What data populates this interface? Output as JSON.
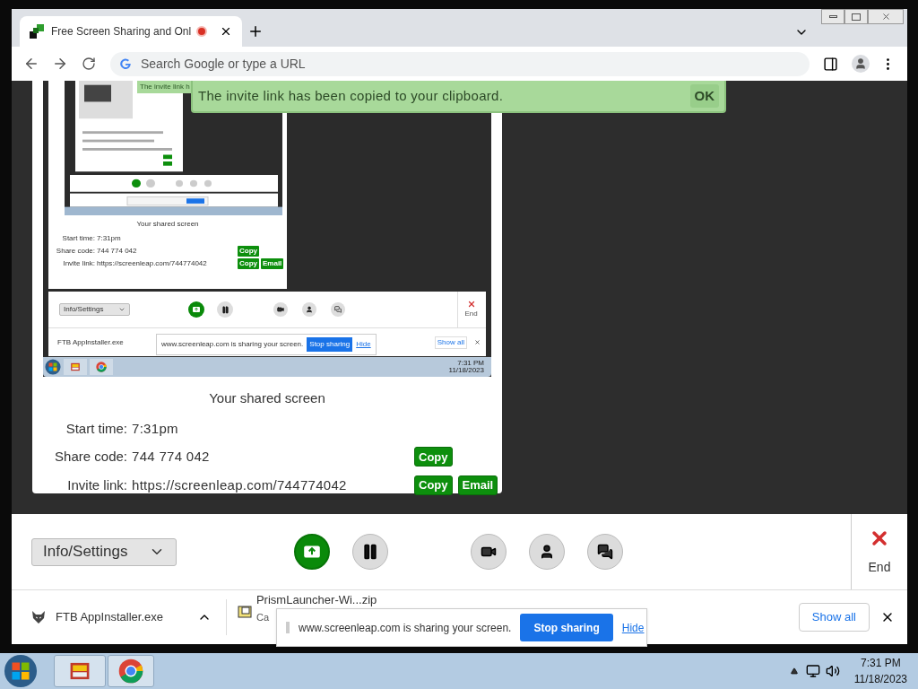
{
  "browser": {
    "tab": {
      "title": "Free Screen Sharing and Onl",
      "recording": true
    },
    "address_bar": {
      "placeholder": "Search Google or type a URL"
    }
  },
  "toast": {
    "message": "The invite link has been copied to your clipboard.",
    "button": "OK"
  },
  "preview": {
    "toast": "The invite link h",
    "heading": "Your shared screen",
    "rows": [
      {
        "label": "Start time:",
        "value": "7:31pm"
      },
      {
        "label": "Share code:",
        "value": "744 774 042",
        "buttons": [
          "Copy"
        ]
      },
      {
        "label": "Invite link:",
        "value": "https://screenleap.com/744774042",
        "buttons": [
          "Copy",
          "Email"
        ]
      }
    ],
    "dropdown": "Info/Settings",
    "end": "End",
    "download": "FTB AppInstaller.exe",
    "sharing_bar": {
      "message": "www.screenleap.com is sharing your screen.",
      "stop": "Stop sharing",
      "hide": "Hide"
    },
    "show_all": "Show all",
    "time": "7:31 PM",
    "date": "11/18/2023"
  },
  "shared_screen": {
    "heading": "Your shared screen",
    "rows": [
      {
        "label": "Start time:",
        "value": "7:31pm"
      },
      {
        "label": "Share code:",
        "value": "744 774 042",
        "buttons": [
          "Copy"
        ]
      },
      {
        "label": "Invite link:",
        "value": "https://screenleap.com/744774042",
        "buttons": [
          "Copy",
          "Email"
        ]
      }
    ]
  },
  "controls": {
    "dropdown": "Info/Settings",
    "end": "End"
  },
  "downloads": {
    "items": [
      {
        "name": "FTB AppInstaller.exe"
      },
      {
        "name": "PrismLauncher-Wi...zip",
        "status": "Ca"
      }
    ],
    "show_all": "Show all"
  },
  "sharing_bar": {
    "message": "www.screenleap.com is sharing your screen.",
    "stop": "Stop sharing",
    "hide": "Hide"
  },
  "taskbar": {
    "time": "7:31 PM",
    "date": "11/18/2023"
  }
}
